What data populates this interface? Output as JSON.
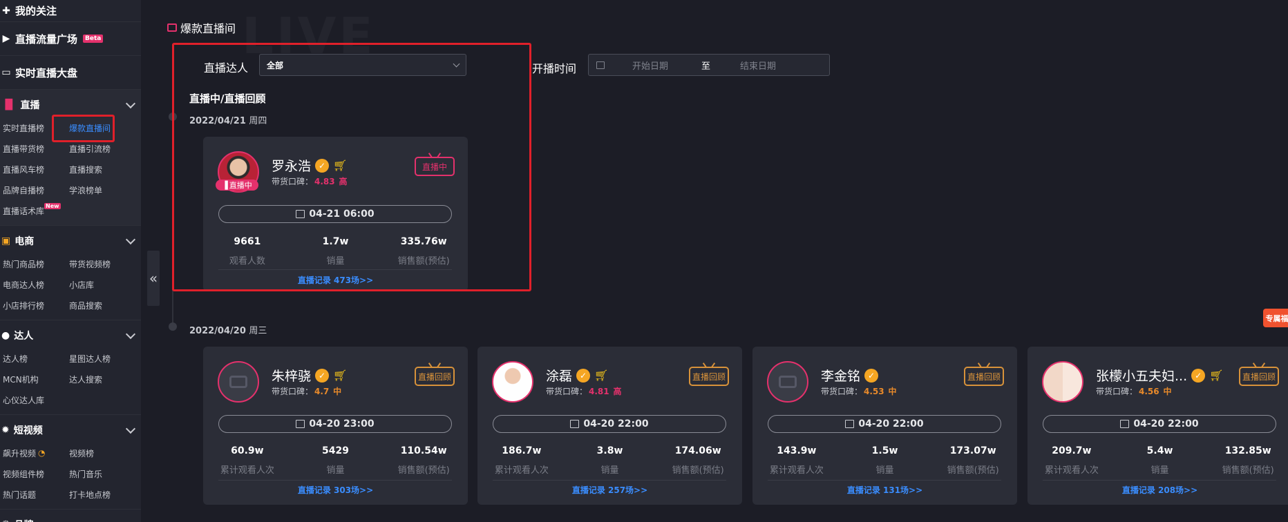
{
  "sidebar": {
    "follow": "我的关注",
    "traffic": "直播流量广场",
    "traffic_badge": "Beta",
    "realtime": "实时直播大盘",
    "sections": [
      {
        "title": "直播",
        "items": [
          "实时直播榜",
          "爆款直播间",
          "直播带货榜",
          "直播引流榜",
          "直播风车榜",
          "直播搜索",
          "品牌自播榜",
          "学浪榜单",
          "直播话术库"
        ],
        "new_badge": "New"
      },
      {
        "title": "电商",
        "items": [
          "热门商品榜",
          "带货视频榜",
          "电商达人榜",
          "小店库",
          "小店排行榜",
          "商品搜索"
        ]
      },
      {
        "title": "达人",
        "items": [
          "达人榜",
          "星图达人榜",
          "MCN机构",
          "达人搜索",
          "心仪达人库"
        ]
      },
      {
        "title": "短视频",
        "items": [
          "飙升视频",
          "视频榜",
          "视频组件榜",
          "热门音乐",
          "热门话题",
          "打卡地点榜"
        ]
      },
      {
        "title": "品牌"
      }
    ]
  },
  "page": {
    "title": "爆款直播间",
    "anchor_label": "直播达人",
    "anchor_value": "全部",
    "time_label": "开播时间",
    "start_placeholder": "开始日期",
    "to": "至",
    "end_placeholder": "结束日期",
    "section_title": "直播中/直播回顾",
    "side_tag": "专属福"
  },
  "groups": [
    {
      "date": "2022/04/21",
      "weekday": "周四",
      "cards": [
        {
          "name": "罗永浩",
          "rating_label": "带货口碑：",
          "rating": "4.83",
          "level": "高",
          "status": "直播中",
          "live_badge": "直播中",
          "time": "04-21 06:00",
          "stats": [
            {
              "v": "9661",
              "l": "观看人数"
            },
            {
              "v": "1.7w",
              "l": "销量"
            },
            {
              "v": "335.76w",
              "l": "销售额(预估)"
            }
          ],
          "record": "直播记录 473场>>"
        }
      ]
    },
    {
      "date": "2022/04/20",
      "weekday": "周三",
      "cards": [
        {
          "name": "朱梓骁",
          "rating_label": "带货口碑：",
          "rating": "4.7",
          "level": "中",
          "status": "直播回顾",
          "time": "04-20 23:00",
          "stats": [
            {
              "v": "60.9w",
              "l": "累计观看人次"
            },
            {
              "v": "5429",
              "l": "销量"
            },
            {
              "v": "110.54w",
              "l": "销售额(预估)"
            }
          ],
          "record": "直播记录 303场>>"
        },
        {
          "name": "涂磊",
          "rating_label": "带货口碑：",
          "rating": "4.81",
          "level": "高",
          "status": "直播回顾",
          "time": "04-20 22:00",
          "stats": [
            {
              "v": "186.7w",
              "l": "累计观看人次"
            },
            {
              "v": "3.8w",
              "l": "销量"
            },
            {
              "v": "174.06w",
              "l": "销售额(预估)"
            }
          ],
          "record": "直播记录 257场>>"
        },
        {
          "name": "李金铭",
          "rating_label": "带货口碑：",
          "rating": "4.53",
          "level": "中",
          "status": "直播回顾",
          "time": "04-20 22:00",
          "stats": [
            {
              "v": "143.9w",
              "l": "累计观看人次"
            },
            {
              "v": "1.5w",
              "l": "销量"
            },
            {
              "v": "173.07w",
              "l": "销售额(预估)"
            }
          ],
          "record": "直播记录 131场>>"
        },
        {
          "name": "张檬小五夫妇...",
          "rating_label": "带货口碑：",
          "rating": "4.56",
          "level": "中",
          "status": "直播回顾",
          "time": "04-20 22:00",
          "stats": [
            {
              "v": "209.7w",
              "l": "累计观看人次"
            },
            {
              "v": "5.4w",
              "l": "销量"
            },
            {
              "v": "132.85w",
              "l": "销售额(预估)"
            }
          ],
          "record": "直播记录 208场>>"
        }
      ]
    }
  ],
  "colors": {
    "accent": "#e4316c",
    "link": "#3a8dff",
    "replay": "#d8923a",
    "highlight": "#e0202a"
  }
}
